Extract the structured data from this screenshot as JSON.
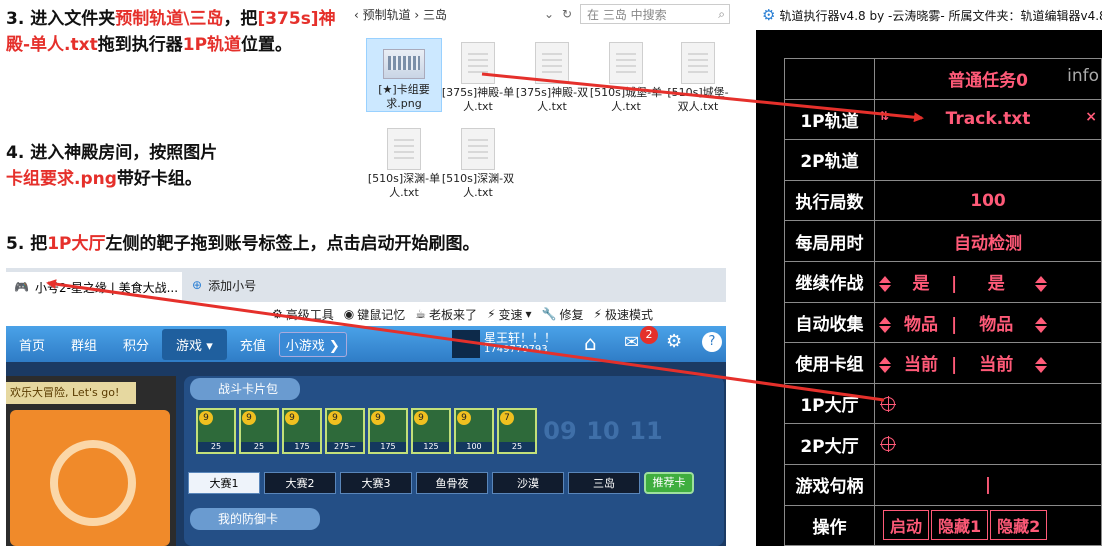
{
  "instructions": {
    "step3": {
      "p1": "3. 进入文件夹",
      "r1": "预制轨道\\三岛",
      "p2": "，把",
      "r2": "[375s]神殿-单人.txt",
      "p3": "拖到执行器",
      "r3": "1P轨道",
      "p4": "位置。"
    },
    "step4": {
      "p1": "4. 进入神殿房间，按照图片",
      "r1": "卡组要求.png",
      "p2": "带好卡组。"
    },
    "step5": {
      "p1": "5. 把",
      "r1": "1P大厅",
      "p2": "左侧的靶子拖到账号标签上，点击启动开始刷图。"
    }
  },
  "explorer": {
    "breadcrumb": "‹ 预制轨道 › 三岛",
    "search_placeholder": "在 三岛 中搜索",
    "files": [
      {
        "name": "[★]卡组要求.png",
        "kind": "png"
      },
      {
        "name": "[375s]神殿-单人.txt",
        "kind": "txt"
      },
      {
        "name": "[375s]神殿-双人.txt",
        "kind": "txt"
      },
      {
        "name": "[510s]城堡-单人.txt",
        "kind": "txt"
      },
      {
        "name": "[510s]城堡-双人.txt",
        "kind": "txt"
      },
      {
        "name": "[510s]深渊-单人.txt",
        "kind": "txt"
      },
      {
        "name": "[510s]深渊-双人.txt",
        "kind": "txt"
      }
    ]
  },
  "executor": {
    "title": "轨道执行器v4.8 by -云涛晓雾- 所属文件夹：轨道编辑器v4.8",
    "task_label": "普通任务0",
    "info": "info",
    "rows": {
      "track1": {
        "label": "1P轨道",
        "value": "Track.txt"
      },
      "track2": {
        "label": "2P轨道"
      },
      "rounds": {
        "label": "执行局数",
        "value": "100"
      },
      "time": {
        "label": "每局用时",
        "value": "自动检测"
      },
      "continue": {
        "label": "继续作战",
        "a": "是",
        "b": "是"
      },
      "collect": {
        "label": "自动收集",
        "a": "物品",
        "b": "物品"
      },
      "deck": {
        "label": "使用卡组",
        "a": "当前",
        "b": "当前"
      },
      "hall1": {
        "label": "1P大厅"
      },
      "hall2": {
        "label": "2P大厅"
      },
      "handle": {
        "label": "游戏句柄",
        "value": "|"
      },
      "ops": {
        "label": "操作",
        "start": "启动",
        "hide1": "隐藏1",
        "hide2": "隐藏2"
      }
    },
    "sep": "|",
    "close": "×"
  },
  "browser": {
    "tab1": "小号2-星之缘 | 美食大战...",
    "tab2": "添加小号",
    "tools": [
      "高级工具",
      "键鼠记忆",
      "老板来了",
      "变速",
      "修复",
      "极速模式"
    ],
    "nav": [
      "首页",
      "群组",
      "积分",
      "游戏",
      "充值",
      "小游戏"
    ],
    "user_name": "星王轩！！！",
    "user_id": "1749770793",
    "mail_badge": "2"
  },
  "game": {
    "banner": "欢乐大冒险, Let's go!",
    "card_title": "战斗卡片包",
    "cards": [
      {
        "lv": "9",
        "cost": "25"
      },
      {
        "lv": "9",
        "cost": "25"
      },
      {
        "lv": "9",
        "cost": "175"
      },
      {
        "lv": "9",
        "cost": "275~"
      },
      {
        "lv": "9",
        "cost": "175"
      },
      {
        "lv": "9",
        "cost": "125"
      },
      {
        "lv": "9",
        "cost": "100"
      },
      {
        "lv": "7",
        "cost": "25"
      }
    ],
    "slot_numbers": [
      "09",
      "10",
      "11"
    ],
    "maps": [
      "大赛1",
      "大赛2",
      "大赛3",
      "鱼骨夜",
      "沙漠",
      "三岛"
    ],
    "recommend": "推荐卡",
    "defense": "我的防御卡"
  },
  "colors": {
    "accent": "#e5302b",
    "executor_text": "#ff5a78",
    "arrow": "#e5302b"
  }
}
